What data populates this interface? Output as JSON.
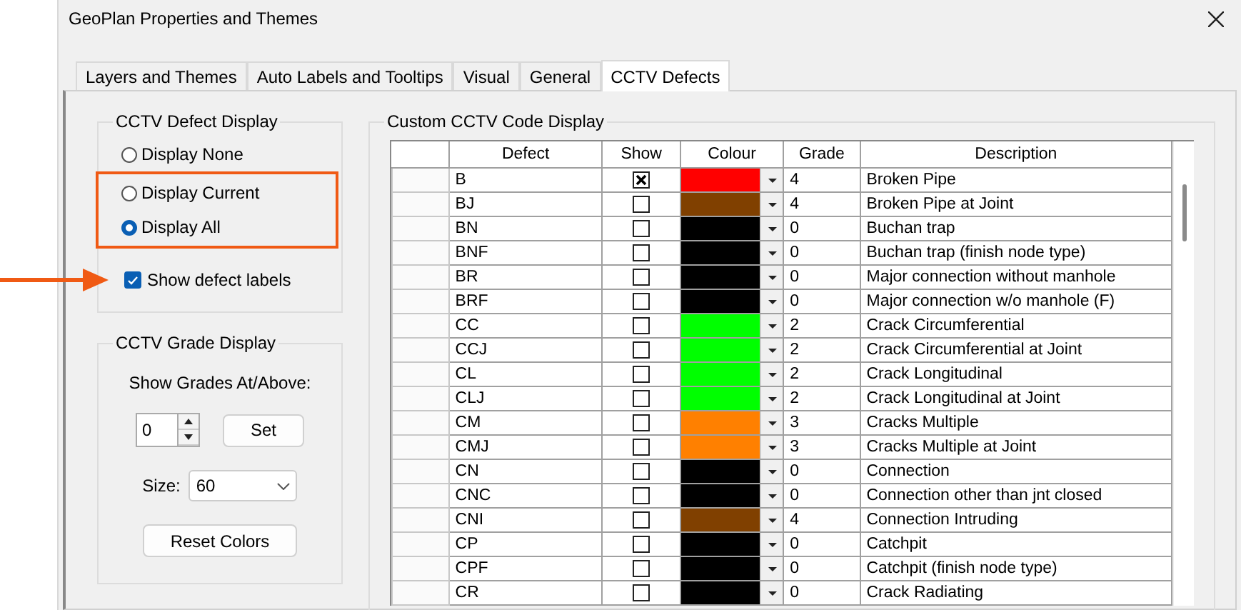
{
  "window": {
    "title": "GeoPlan Properties and Themes"
  },
  "tabs": [
    {
      "label": "Layers and Themes",
      "selected": false
    },
    {
      "label": "Auto Labels and Tooltips",
      "selected": false
    },
    {
      "label": "Visual",
      "selected": false
    },
    {
      "label": "General",
      "selected": false
    },
    {
      "label": "CCTV Defects",
      "selected": true
    }
  ],
  "defect_display": {
    "title": "CCTV Defect Display",
    "options": [
      {
        "label": "Display None",
        "selected": false
      },
      {
        "label": "Display Current",
        "selected": false
      },
      {
        "label": "Display All",
        "selected": true
      }
    ],
    "show_labels": {
      "label": "Show defect labels",
      "checked": true
    }
  },
  "grade_display": {
    "title": "CCTV Grade Display",
    "label": "Show Grades At/Above:",
    "value": "0",
    "set_button": "Set",
    "size_label": "Size:",
    "size_value": "60",
    "reset_button": "Reset Colors"
  },
  "code_display": {
    "title": "Custom CCTV Code Display",
    "columns": [
      "Defect",
      "Show",
      "Colour",
      "Grade",
      "Description"
    ],
    "rows": [
      {
        "defect": "B",
        "show": true,
        "color": "#ff0000",
        "grade": "4",
        "description": "Broken Pipe"
      },
      {
        "defect": "BJ",
        "show": false,
        "color": "#804000",
        "grade": "4",
        "description": "Broken Pipe at Joint"
      },
      {
        "defect": "BN",
        "show": false,
        "color": "#000000",
        "grade": "0",
        "description": "Buchan trap"
      },
      {
        "defect": "BNF",
        "show": false,
        "color": "#000000",
        "grade": "0",
        "description": "Buchan trap (finish node type)"
      },
      {
        "defect": "BR",
        "show": false,
        "color": "#000000",
        "grade": "0",
        "description": "Major connection without manhole"
      },
      {
        "defect": "BRF",
        "show": false,
        "color": "#000000",
        "grade": "0",
        "description": "Major connection w/o manhole (F)"
      },
      {
        "defect": "CC",
        "show": false,
        "color": "#00ff00",
        "grade": "2",
        "description": "Crack Circumferential"
      },
      {
        "defect": "CCJ",
        "show": false,
        "color": "#00ff00",
        "grade": "2",
        "description": "Crack Circumferential at Joint"
      },
      {
        "defect": "CL",
        "show": false,
        "color": "#00ff00",
        "grade": "2",
        "description": "Crack Longitudinal"
      },
      {
        "defect": "CLJ",
        "show": false,
        "color": "#00ff00",
        "grade": "2",
        "description": "Crack Longitudinal at Joint"
      },
      {
        "defect": "CM",
        "show": false,
        "color": "#ff8000",
        "grade": "3",
        "description": "Cracks Multiple"
      },
      {
        "defect": "CMJ",
        "show": false,
        "color": "#ff8000",
        "grade": "3",
        "description": "Cracks Multiple at Joint"
      },
      {
        "defect": "CN",
        "show": false,
        "color": "#000000",
        "grade": "0",
        "description": "Connection"
      },
      {
        "defect": "CNC",
        "show": false,
        "color": "#000000",
        "grade": "0",
        "description": "Connection other than jnt closed"
      },
      {
        "defect": "CNI",
        "show": false,
        "color": "#804000",
        "grade": "4",
        "description": "Connection Intruding"
      },
      {
        "defect": "CP",
        "show": false,
        "color": "#000000",
        "grade": "0",
        "description": "Catchpit"
      },
      {
        "defect": "CPF",
        "show": false,
        "color": "#000000",
        "grade": "0",
        "description": "Catchpit (finish node type)"
      },
      {
        "defect": "CR",
        "show": false,
        "color": "#000000",
        "grade": "0",
        "description": "Crack Radiating"
      }
    ]
  }
}
